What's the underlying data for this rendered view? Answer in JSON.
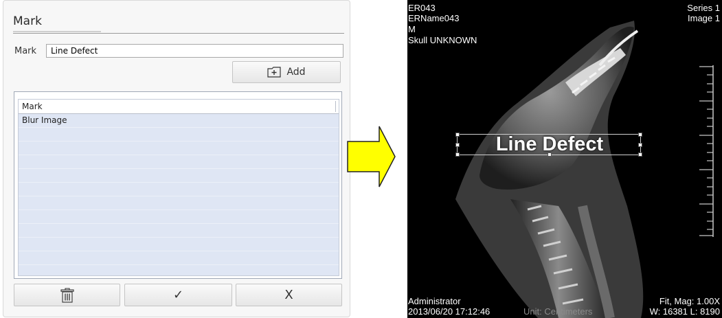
{
  "dialog": {
    "title": "Mark",
    "mark_label": "Mark",
    "mark_value": "Line Defect",
    "add_label": "Add",
    "list": {
      "header": "Mark",
      "items": [
        "Blur Image"
      ]
    },
    "ok_glyph": "✓",
    "cancel_label": "X"
  },
  "viewer": {
    "patient_id": "ER043",
    "patient_name": "ERName043",
    "sex": "M",
    "body_part": "Skull UNKNOWN",
    "series": "Series 1",
    "image": "Image 1",
    "operator": "Administrator",
    "datetime": "2013/06/20 17:12:46",
    "unit": "Unit: Centimeters",
    "magnification": "Fit, Mag: 1.00X",
    "window_level": "W: 16381 L: 8190",
    "annotation": "Line Defect"
  },
  "colors": {
    "arrow_fill": "#ffff00",
    "list_background": "#dfe6f4",
    "viewer_background": "#000000"
  },
  "icons": {
    "add": "plus-box-icon",
    "delete": "trash-icon",
    "ok": "checkmark-icon",
    "arrow": "right-arrow-icon"
  }
}
